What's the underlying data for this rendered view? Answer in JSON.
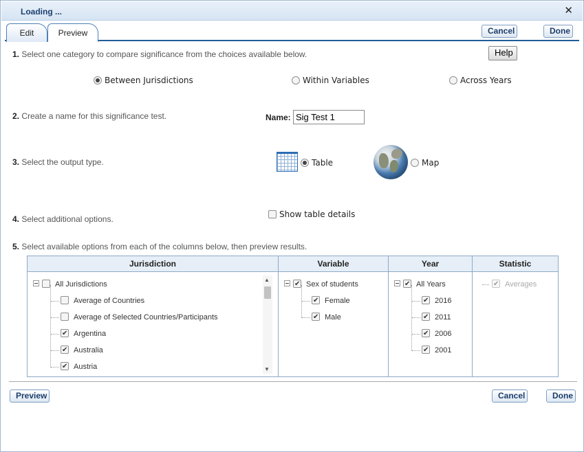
{
  "window": {
    "title": "Loading ...",
    "close_glyph": "✕"
  },
  "tabs": [
    {
      "label": "Edit"
    },
    {
      "label": "Preview"
    }
  ],
  "toolbar": {
    "cancel_label": "Cancel",
    "done_label": "Done",
    "help_label": "Help"
  },
  "steps": {
    "s1": {
      "num": "1.",
      "text": " Select one category to compare significance from the choices available below."
    },
    "s2": {
      "num": "2.",
      "text": " Create a name for this significance test."
    },
    "s3": {
      "num": "3.",
      "text": " Select the output type."
    },
    "s4": {
      "num": "4.",
      "text": " Select additional options."
    },
    "s5": {
      "num": "5.",
      "text": " Select available options from each of the columns below, then preview results."
    }
  },
  "compare_options": [
    {
      "label": "Between Jurisdictions",
      "selected": true
    },
    {
      "label": "Within Variables",
      "selected": false
    },
    {
      "label": "Across Years",
      "selected": false
    }
  ],
  "name": {
    "label": "Name:",
    "value": "Sig Test 1"
  },
  "output_types": [
    {
      "label": "Table",
      "selected": true,
      "icon": "table-grid-icon"
    },
    {
      "label": "Map",
      "selected": false,
      "icon": "globe-icon"
    }
  ],
  "additional": {
    "show_details_label": "Show table details",
    "checked": false
  },
  "grid": {
    "headers": {
      "jurisdiction": "Jurisdiction",
      "variable": "Variable",
      "year": "Year",
      "statistic": "Statistic"
    },
    "jurisdiction": {
      "root": {
        "label": "All Jurisdictions",
        "checked": false
      },
      "items": [
        {
          "label": "Average of Countries",
          "checked": false
        },
        {
          "label": "Average of Selected Countries/Participants",
          "checked": false
        },
        {
          "label": "Argentina",
          "checked": true
        },
        {
          "label": "Australia",
          "checked": true
        },
        {
          "label": "Austria",
          "checked": true
        }
      ]
    },
    "variable": {
      "root": {
        "label": "Sex of students",
        "checked": true
      },
      "items": [
        {
          "label": "Female",
          "checked": true
        },
        {
          "label": "Male",
          "checked": true
        }
      ]
    },
    "year": {
      "root": {
        "label": "All Years",
        "checked": true
      },
      "items": [
        {
          "label": "2016",
          "checked": true
        },
        {
          "label": "2011",
          "checked": true
        },
        {
          "label": "2006",
          "checked": true
        },
        {
          "label": "2001",
          "checked": true
        }
      ]
    },
    "statistic": {
      "items": [
        {
          "label": "Averages",
          "checked": true,
          "disabled": true
        }
      ]
    }
  },
  "footer": {
    "preview_label": "Preview",
    "cancel_label": "Cancel",
    "done_label": "Done"
  }
}
